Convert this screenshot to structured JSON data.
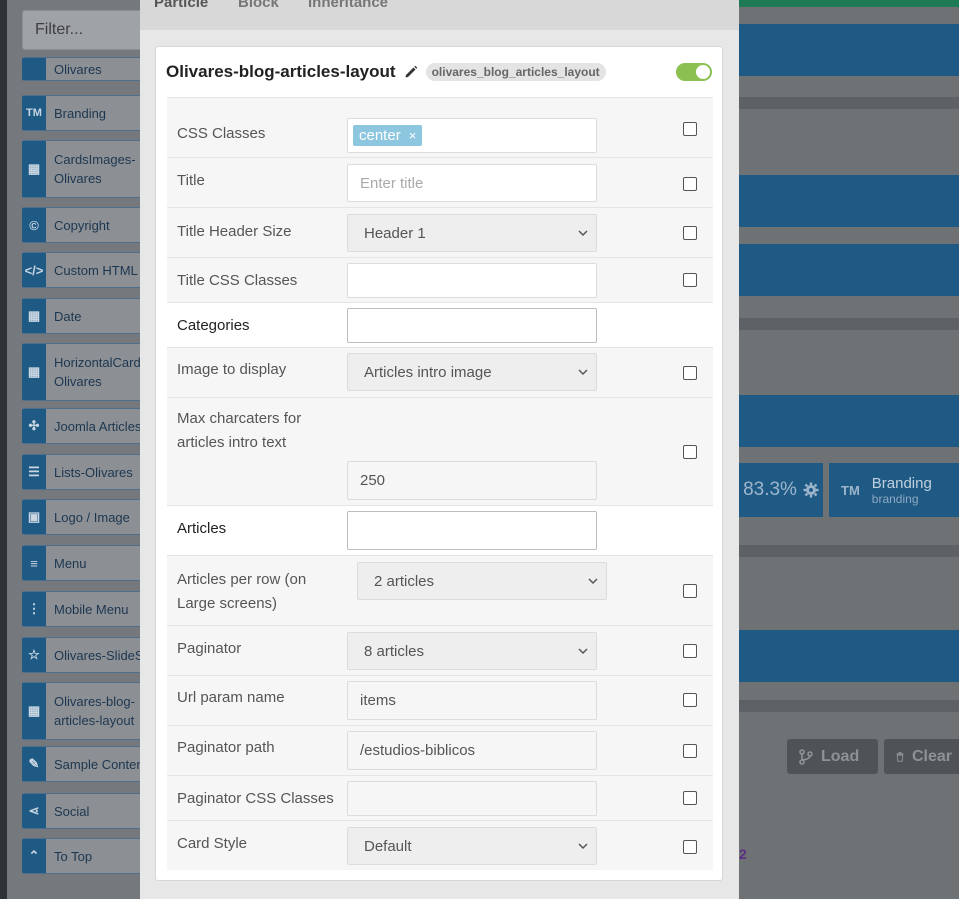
{
  "sidebar": {
    "filter_placeholder": "Filter...",
    "items": [
      {
        "icon": "olivares-icon",
        "label": "Olivares"
      },
      {
        "icon": "tm",
        "label": "Branding"
      },
      {
        "icon": "grid",
        "label": "CardsImages-\nOlivares"
      },
      {
        "icon": "©",
        "label": "Copyright"
      },
      {
        "icon": "</>",
        "label": "Custom HTML"
      },
      {
        "icon": "calendar",
        "label": "Date"
      },
      {
        "icon": "grid",
        "label": "HorizontalCard\nOlivares"
      },
      {
        "icon": "joomla",
        "label": "Joomla Articles"
      },
      {
        "icon": "list",
        "label": "Lists-Olivares"
      },
      {
        "icon": "image",
        "label": "Logo / Image"
      },
      {
        "icon": "menu",
        "label": "Menu"
      },
      {
        "icon": "dots",
        "label": "Mobile Menu"
      },
      {
        "icon": "star",
        "label": "Olivares-SlideS"
      },
      {
        "icon": "grid",
        "label": "Olivares-blog-\narticles-layout"
      },
      {
        "icon": "edit",
        "label": "Sample Content"
      },
      {
        "icon": "share",
        "label": "Social"
      },
      {
        "icon": "up",
        "label": "To Top"
      }
    ]
  },
  "tabs": [
    "Particle",
    "Block",
    "Inheritance"
  ],
  "panel": {
    "title": "Olivares-blog-articles-layout",
    "key": "olivares_blog_articles_layout",
    "enabled": true
  },
  "fields": {
    "css_classes": {
      "label": "CSS Classes",
      "tag": "center",
      "tag_remove": "×"
    },
    "title": {
      "label": "Title",
      "placeholder": "Enter title"
    },
    "title_header_size": {
      "label": "Title Header Size",
      "value": "Header 1"
    },
    "title_css_classes": {
      "label": "Title CSS Classes",
      "value": ""
    },
    "categories": {
      "label": "Categories",
      "value": ""
    },
    "image_to_display": {
      "label": "Image to display",
      "value": "Articles intro image"
    },
    "max_chars": {
      "label_1": "Max charcaters for",
      "label_2": "articles intro text",
      "value": "250"
    },
    "articles": {
      "label": "Articles",
      "value": ""
    },
    "articles_per_row": {
      "label_1": "Articles per row (on",
      "label_2": "Large screens)",
      "value": "2 articles"
    },
    "paginator": {
      "label": "Paginator",
      "value": "8 articles"
    },
    "url_param": {
      "label": "Url param name",
      "value": "items"
    },
    "paginator_path": {
      "label": "Paginator path",
      "value": "/estudios-biblicos"
    },
    "paginator_css": {
      "label": "Paginator CSS Classes",
      "value": ""
    },
    "card_style": {
      "label": "Card Style",
      "value": "Default"
    }
  },
  "background": {
    "percent": "83.3%",
    "branding_title": "Branding",
    "branding_sub": "branding",
    "tm": "TM",
    "load_label": "Load",
    "clear_label": "Clear",
    "purple_text": "2"
  }
}
